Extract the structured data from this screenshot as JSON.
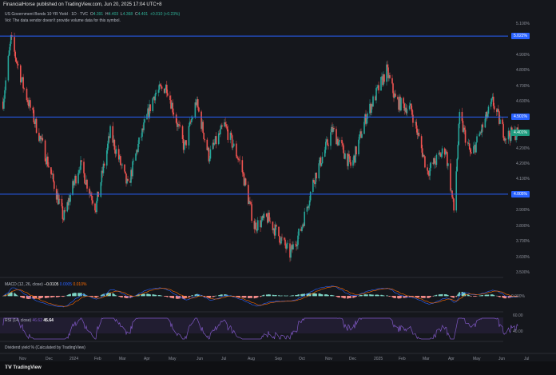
{
  "header": "FinancialHorse published on TradingView.com, Jun 20, 2025 17:04 UTC+8",
  "legend": {
    "symbol": "US Government Bonds 10 YR Yield · 1D · TVC",
    "o_label": "O",
    "o": "4.391",
    "h_label": "H",
    "h": "4.403",
    "l_label": "L",
    "l": "4.368",
    "c_label": "C",
    "c": "4.401",
    "change": "+0.010 (+0.23%)"
  },
  "volume_note": "Vol: The data vendor doesn't provide volume data for this symbol.",
  "colors": {
    "up": "#26a69a",
    "down": "#ef5350",
    "hline": "#2962ff",
    "rsi": "#7e57c2",
    "macd": "#2962ff",
    "signal": "#ff6d00"
  },
  "chart_data": {
    "type": "candlestick",
    "y_ticks": [
      "5.100%",
      "4.900%",
      "4.800%",
      "4.700%",
      "4.600%",
      "4.200%",
      "4.200%",
      "4.100%",
      "3.900%",
      "3.800%",
      "3.700%",
      "3.600%",
      "3.500%"
    ],
    "ylim": [
      3.5,
      5.1
    ],
    "x_ticks": [
      "Nov",
      "Dec",
      "2024",
      "Feb",
      "Mar",
      "Apr",
      "May",
      "Jun",
      "Jul",
      "Aug",
      "Sep",
      "Oct",
      "Nov",
      "Dec",
      "2025",
      "Feb",
      "Mar",
      "Apr",
      "May",
      "Jun",
      "Jul"
    ],
    "approx_path": [
      [
        "2023-10-10",
        4.6
      ],
      [
        "2023-10-19",
        5.0
      ],
      [
        "2023-11-02",
        4.7
      ],
      [
        "2023-11-22",
        4.35
      ],
      [
        "2023-12-20",
        3.85
      ],
      [
        "2024-01-10",
        4.2
      ],
      [
        "2024-01-30",
        3.92
      ],
      [
        "2024-02-16",
        4.4
      ],
      [
        "2024-03-08",
        4.05
      ],
      [
        "2024-03-20",
        4.3
      ],
      [
        "2024-04-10",
        4.65
      ],
      [
        "2024-04-25",
        4.7
      ],
      [
        "2024-05-15",
        4.3
      ],
      [
        "2024-05-28",
        4.6
      ],
      [
        "2024-06-12",
        4.25
      ],
      [
        "2024-07-01",
        4.45
      ],
      [
        "2024-07-20",
        4.2
      ],
      [
        "2024-08-05",
        3.8
      ],
      [
        "2024-08-20",
        3.85
      ],
      [
        "2024-09-16",
        3.62
      ],
      [
        "2024-09-30",
        3.78
      ],
      [
        "2024-10-15",
        4.1
      ],
      [
        "2024-11-06",
        4.42
      ],
      [
        "2024-11-30",
        4.18
      ],
      [
        "2024-12-18",
        4.5
      ],
      [
        "2025-01-13",
        4.8
      ],
      [
        "2025-01-25",
        4.6
      ],
      [
        "2025-02-12",
        4.55
      ],
      [
        "2025-03-03",
        4.15
      ],
      [
        "2025-03-25",
        4.3
      ],
      [
        "2025-04-04",
        3.9
      ],
      [
        "2025-04-11",
        4.5
      ],
      [
        "2025-04-25",
        4.25
      ],
      [
        "2025-05-21",
        4.6
      ],
      [
        "2025-06-05",
        4.38
      ],
      [
        "2025-06-20",
        4.401
      ]
    ],
    "horizontal_levels": [
      {
        "value": 5.022,
        "label": "5.022%"
      },
      {
        "value": 4.501,
        "label": "4.501%"
      },
      {
        "value": 4.005,
        "label": "4.005%"
      }
    ],
    "last_price": {
      "value": 4.401,
      "label": "4.401%"
    }
  },
  "macd": {
    "title": "MACD (12, 26, close)",
    "macd": "−0.0105",
    "signal": "0.0005",
    "hist": "0.010%",
    "zero_label": "0.000%"
  },
  "rsi": {
    "title": "RSI (14, close)",
    "ma": "46.62",
    "value": "45.64",
    "upper_label": "60.00",
    "lower_label": "40.00"
  },
  "dividend": "Dividend yield % (Calculated by TradingView)",
  "footer": "TradingView"
}
